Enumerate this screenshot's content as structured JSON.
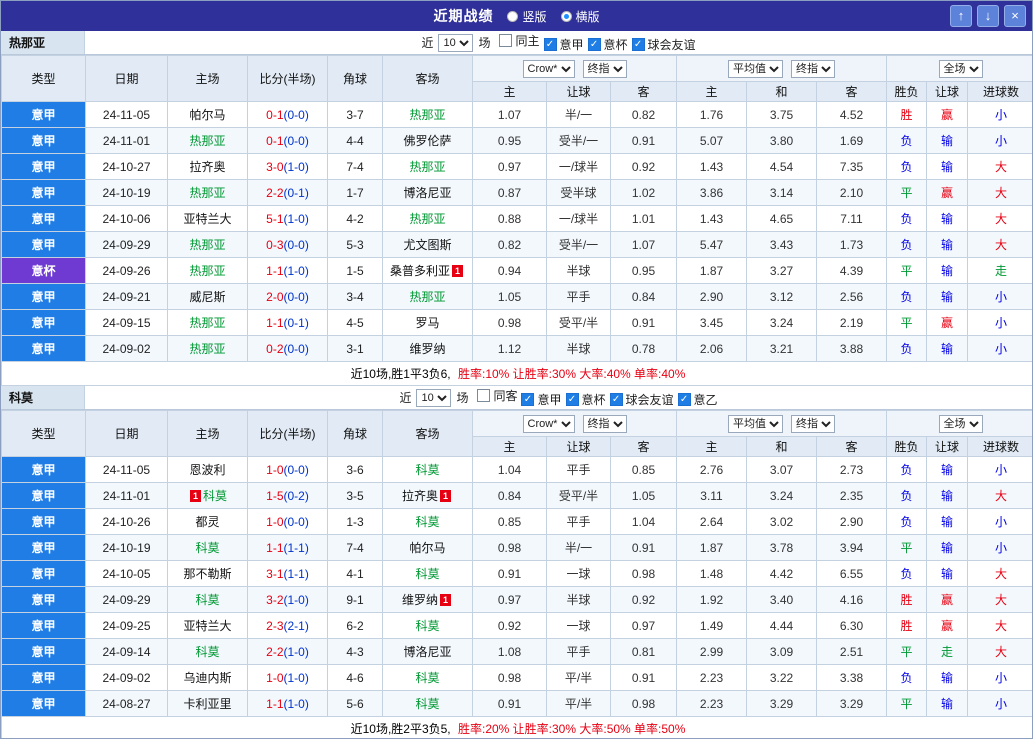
{
  "titlebar": {
    "title": "近期战绩",
    "radios": [
      {
        "label": "竖版",
        "selected": false
      },
      {
        "label": "横版",
        "selected": true
      }
    ],
    "buttons": {
      "up": "↑",
      "down": "↓",
      "close": "×"
    }
  },
  "sections": [
    {
      "team": "热那亚",
      "filter": {
        "near": "近",
        "count": "10",
        "games": "场",
        "checkboxes": [
          {
            "label": "同主",
            "checked": false
          },
          {
            "label": "意甲",
            "checked": true
          },
          {
            "label": "意杯",
            "checked": true
          },
          {
            "label": "球会友谊",
            "checked": true
          }
        ]
      },
      "header": {
        "cols": [
          "类型",
          "日期",
          "主场",
          "比分(半场)",
          "角球",
          "客场"
        ],
        "bookmaker": "Crow*",
        "final_odds1": "终指",
        "average": "平均值",
        "final_odds2": "终指",
        "full_match": "全场",
        "sub": [
          "主",
          "让球",
          "客",
          "主",
          "和",
          "客",
          "胜负",
          "让球",
          "进球数"
        ]
      },
      "rows": [
        {
          "league": "意甲",
          "lg": "blue",
          "date": "24-11-05",
          "home": {
            "name": "帕尔马"
          },
          "score": {
            "ft": "0-1",
            "ht": "(0-0)"
          },
          "corner": "3-7",
          "away": {
            "name": "热那亚",
            "focus": true
          },
          "odds": [
            "1.07",
            "半/一",
            "0.82",
            "1.76",
            "3.75",
            "4.52"
          ],
          "res": [
            {
              "t": "胜",
              "c": "w"
            },
            {
              "t": "赢",
              "c": "w"
            },
            {
              "t": "小",
              "c": "l"
            }
          ]
        },
        {
          "league": "意甲",
          "lg": "blue",
          "date": "24-11-01",
          "home": {
            "name": "热那亚",
            "focus": true
          },
          "score": {
            "ft": "0-1",
            "ht": "(0-0)"
          },
          "corner": "4-4",
          "away": {
            "name": "佛罗伦萨"
          },
          "odds": [
            "0.95",
            "受半/一",
            "0.91",
            "5.07",
            "3.80",
            "1.69"
          ],
          "res": [
            {
              "t": "负",
              "c": "l"
            },
            {
              "t": "输",
              "c": "l"
            },
            {
              "t": "小",
              "c": "l"
            }
          ]
        },
        {
          "league": "意甲",
          "lg": "blue",
          "date": "24-10-27",
          "home": {
            "name": "拉齐奥"
          },
          "score": {
            "ft": "3-0",
            "ht": "(1-0)"
          },
          "corner": "7-4",
          "away": {
            "name": "热那亚",
            "focus": true
          },
          "odds": [
            "0.97",
            "一/球半",
            "0.92",
            "1.43",
            "4.54",
            "7.35"
          ],
          "res": [
            {
              "t": "负",
              "c": "l"
            },
            {
              "t": "输",
              "c": "l"
            },
            {
              "t": "大",
              "c": "w"
            }
          ]
        },
        {
          "league": "意甲",
          "lg": "blue",
          "date": "24-10-19",
          "home": {
            "name": "热那亚",
            "focus": true
          },
          "score": {
            "ft": "2-2",
            "ht": "(0-1)"
          },
          "corner": "1-7",
          "away": {
            "name": "博洛尼亚"
          },
          "odds": [
            "0.87",
            "受半球",
            "1.02",
            "3.86",
            "3.14",
            "2.10"
          ],
          "res": [
            {
              "t": "平",
              "c": "d"
            },
            {
              "t": "赢",
              "c": "w"
            },
            {
              "t": "大",
              "c": "w"
            }
          ]
        },
        {
          "league": "意甲",
          "lg": "blue",
          "date": "24-10-06",
          "home": {
            "name": "亚特兰大"
          },
          "score": {
            "ft": "5-1",
            "ht": "(1-0)"
          },
          "corner": "4-2",
          "away": {
            "name": "热那亚",
            "focus": true
          },
          "odds": [
            "0.88",
            "一/球半",
            "1.01",
            "1.43",
            "4.65",
            "7.11"
          ],
          "res": [
            {
              "t": "负",
              "c": "l"
            },
            {
              "t": "输",
              "c": "l"
            },
            {
              "t": "大",
              "c": "w"
            }
          ]
        },
        {
          "league": "意甲",
          "lg": "blue",
          "date": "24-09-29",
          "home": {
            "name": "热那亚",
            "focus": true
          },
          "score": {
            "ft": "0-3",
            "ht": "(0-0)"
          },
          "corner": "5-3",
          "away": {
            "name": "尤文图斯"
          },
          "odds": [
            "0.82",
            "受半/一",
            "1.07",
            "5.47",
            "3.43",
            "1.73"
          ],
          "res": [
            {
              "t": "负",
              "c": "l"
            },
            {
              "t": "输",
              "c": "l"
            },
            {
              "t": "大",
              "c": "w"
            }
          ]
        },
        {
          "league": "意杯",
          "lg": "purple",
          "date": "24-09-26",
          "home": {
            "name": "热那亚",
            "focus": true
          },
          "score": {
            "ft": "1-1",
            "ht": "(1-0)"
          },
          "corner": "1-5",
          "away": {
            "name": "桑普多利亚",
            "card": "1",
            "card_pos": "after"
          },
          "odds": [
            "0.94",
            "半球",
            "0.95",
            "1.87",
            "3.27",
            "4.39"
          ],
          "res": [
            {
              "t": "平",
              "c": "d"
            },
            {
              "t": "输",
              "c": "l"
            },
            {
              "t": "走",
              "c": "d"
            }
          ]
        },
        {
          "league": "意甲",
          "lg": "blue",
          "date": "24-09-21",
          "home": {
            "name": "威尼斯"
          },
          "score": {
            "ft": "2-0",
            "ht": "(0-0)"
          },
          "corner": "3-4",
          "away": {
            "name": "热那亚",
            "focus": true
          },
          "odds": [
            "1.05",
            "平手",
            "0.84",
            "2.90",
            "3.12",
            "2.56"
          ],
          "res": [
            {
              "t": "负",
              "c": "l"
            },
            {
              "t": "输",
              "c": "l"
            },
            {
              "t": "小",
              "c": "l"
            }
          ]
        },
        {
          "league": "意甲",
          "lg": "blue",
          "date": "24-09-15",
          "home": {
            "name": "热那亚",
            "focus": true
          },
          "score": {
            "ft": "1-1",
            "ht": "(0-1)"
          },
          "corner": "4-5",
          "away": {
            "name": "罗马"
          },
          "odds": [
            "0.98",
            "受平/半",
            "0.91",
            "3.45",
            "3.24",
            "2.19"
          ],
          "res": [
            {
              "t": "平",
              "c": "d"
            },
            {
              "t": "赢",
              "c": "w"
            },
            {
              "t": "小",
              "c": "l"
            }
          ]
        },
        {
          "league": "意甲",
          "lg": "blue",
          "date": "24-09-02",
          "home": {
            "name": "热那亚",
            "focus": true
          },
          "score": {
            "ft": "0-2",
            "ht": "(0-0)"
          },
          "corner": "3-1",
          "away": {
            "name": "维罗纳"
          },
          "odds": [
            "1.12",
            "半球",
            "0.78",
            "2.06",
            "3.21",
            "3.88"
          ],
          "res": [
            {
              "t": "负",
              "c": "l"
            },
            {
              "t": "输",
              "c": "l"
            },
            {
              "t": "小",
              "c": "l"
            }
          ]
        }
      ],
      "summary": {
        "record": "近10场,胜1平3负6,",
        "rates": "胜率:10% 让胜率:30% 大率:40% 单率:40%"
      }
    },
    {
      "team": "科莫",
      "filter": {
        "near": "近",
        "count": "10",
        "games": "场",
        "checkboxes": [
          {
            "label": "同客",
            "checked": false
          },
          {
            "label": "意甲",
            "checked": true
          },
          {
            "label": "意杯",
            "checked": true
          },
          {
            "label": "球会友谊",
            "checked": true
          },
          {
            "label": "意乙",
            "checked": true
          }
        ]
      },
      "header": {
        "cols": [
          "类型",
          "日期",
          "主场",
          "比分(半场)",
          "角球",
          "客场"
        ],
        "bookmaker": "Crow*",
        "final_odds1": "终指",
        "average": "平均值",
        "final_odds2": "终指",
        "full_match": "全场",
        "sub": [
          "主",
          "让球",
          "客",
          "主",
          "和",
          "客",
          "胜负",
          "让球",
          "进球数"
        ]
      },
      "rows": [
        {
          "league": "意甲",
          "lg": "blue",
          "date": "24-11-05",
          "home": {
            "name": "恩波利"
          },
          "score": {
            "ft": "1-0",
            "ht": "(0-0)"
          },
          "corner": "3-6",
          "away": {
            "name": "科莫",
            "focus": true
          },
          "odds": [
            "1.04",
            "平手",
            "0.85",
            "2.76",
            "3.07",
            "2.73"
          ],
          "res": [
            {
              "t": "负",
              "c": "l"
            },
            {
              "t": "输",
              "c": "l"
            },
            {
              "t": "小",
              "c": "l"
            }
          ]
        },
        {
          "league": "意甲",
          "lg": "blue",
          "date": "24-11-01",
          "home": {
            "name": "科莫",
            "focus": true,
            "card": "1",
            "card_pos": "before"
          },
          "score": {
            "ft": "1-5",
            "ht": "(0-2)"
          },
          "corner": "3-5",
          "away": {
            "name": "拉齐奥",
            "card": "1",
            "card_pos": "after"
          },
          "odds": [
            "0.84",
            "受平/半",
            "1.05",
            "3.11",
            "3.24",
            "2.35"
          ],
          "res": [
            {
              "t": "负",
              "c": "l"
            },
            {
              "t": "输",
              "c": "l"
            },
            {
              "t": "大",
              "c": "w"
            }
          ]
        },
        {
          "league": "意甲",
          "lg": "blue",
          "date": "24-10-26",
          "home": {
            "name": "都灵"
          },
          "score": {
            "ft": "1-0",
            "ht": "(0-0)"
          },
          "corner": "1-3",
          "away": {
            "name": "科莫",
            "focus": true
          },
          "odds": [
            "0.85",
            "平手",
            "1.04",
            "2.64",
            "3.02",
            "2.90"
          ],
          "res": [
            {
              "t": "负",
              "c": "l"
            },
            {
              "t": "输",
              "c": "l"
            },
            {
              "t": "小",
              "c": "l"
            }
          ]
        },
        {
          "league": "意甲",
          "lg": "blue",
          "date": "24-10-19",
          "home": {
            "name": "科莫",
            "focus": true
          },
          "score": {
            "ft": "1-1",
            "ht": "(1-1)"
          },
          "corner": "7-4",
          "away": {
            "name": "帕尔马"
          },
          "odds": [
            "0.98",
            "半/一",
            "0.91",
            "1.87",
            "3.78",
            "3.94"
          ],
          "res": [
            {
              "t": "平",
              "c": "d"
            },
            {
              "t": "输",
              "c": "l"
            },
            {
              "t": "小",
              "c": "l"
            }
          ]
        },
        {
          "league": "意甲",
          "lg": "blue",
          "date": "24-10-05",
          "home": {
            "name": "那不勒斯"
          },
          "score": {
            "ft": "3-1",
            "ht": "(1-1)"
          },
          "corner": "4-1",
          "away": {
            "name": "科莫",
            "focus": true
          },
          "odds": [
            "0.91",
            "一球",
            "0.98",
            "1.48",
            "4.42",
            "6.55"
          ],
          "res": [
            {
              "t": "负",
              "c": "l"
            },
            {
              "t": "输",
              "c": "l"
            },
            {
              "t": "大",
              "c": "w"
            }
          ]
        },
        {
          "league": "意甲",
          "lg": "blue",
          "date": "24-09-29",
          "home": {
            "name": "科莫",
            "focus": true
          },
          "score": {
            "ft": "3-2",
            "ht": "(1-0)"
          },
          "corner": "9-1",
          "away": {
            "name": "维罗纳",
            "card": "1",
            "card_pos": "after"
          },
          "odds": [
            "0.97",
            "半球",
            "0.92",
            "1.92",
            "3.40",
            "4.16"
          ],
          "res": [
            {
              "t": "胜",
              "c": "w"
            },
            {
              "t": "赢",
              "c": "w"
            },
            {
              "t": "大",
              "c": "w"
            }
          ]
        },
        {
          "league": "意甲",
          "lg": "blue",
          "date": "24-09-25",
          "home": {
            "name": "亚特兰大"
          },
          "score": {
            "ft": "2-3",
            "ht": "(2-1)"
          },
          "corner": "6-2",
          "away": {
            "name": "科莫",
            "focus": true
          },
          "odds": [
            "0.92",
            "一球",
            "0.97",
            "1.49",
            "4.44",
            "6.30"
          ],
          "res": [
            {
              "t": "胜",
              "c": "w"
            },
            {
              "t": "赢",
              "c": "w"
            },
            {
              "t": "大",
              "c": "w"
            }
          ]
        },
        {
          "league": "意甲",
          "lg": "blue",
          "date": "24-09-14",
          "home": {
            "name": "科莫",
            "focus": true
          },
          "score": {
            "ft": "2-2",
            "ht": "(1-0)"
          },
          "corner": "4-3",
          "away": {
            "name": "博洛尼亚"
          },
          "odds": [
            "1.08",
            "平手",
            "0.81",
            "2.99",
            "3.09",
            "2.51"
          ],
          "res": [
            {
              "t": "平",
              "c": "d"
            },
            {
              "t": "走",
              "c": "d"
            },
            {
              "t": "大",
              "c": "w"
            }
          ]
        },
        {
          "league": "意甲",
          "lg": "blue",
          "date": "24-09-02",
          "home": {
            "name": "乌迪内斯"
          },
          "score": {
            "ft": "1-0",
            "ht": "(1-0)"
          },
          "corner": "4-6",
          "away": {
            "name": "科莫",
            "focus": true
          },
          "odds": [
            "0.98",
            "平/半",
            "0.91",
            "2.23",
            "3.22",
            "3.38"
          ],
          "res": [
            {
              "t": "负",
              "c": "l"
            },
            {
              "t": "输",
              "c": "l"
            },
            {
              "t": "小",
              "c": "l"
            }
          ]
        },
        {
          "league": "意甲",
          "lg": "blue",
          "date": "24-08-27",
          "home": {
            "name": "卡利亚里"
          },
          "score": {
            "ft": "1-1",
            "ht": "(1-0)"
          },
          "corner": "5-6",
          "away": {
            "name": "科莫",
            "focus": true
          },
          "odds": [
            "0.91",
            "平/半",
            "0.98",
            "2.23",
            "3.29",
            "3.29"
          ],
          "res": [
            {
              "t": "平",
              "c": "d"
            },
            {
              "t": "输",
              "c": "l"
            },
            {
              "t": "小",
              "c": "l"
            }
          ]
        }
      ],
      "summary": {
        "record": "近10场,胜2平3负5,",
        "rates": "胜率:20% 让胜率:30% 大率:50% 单率:50%"
      }
    }
  ]
}
